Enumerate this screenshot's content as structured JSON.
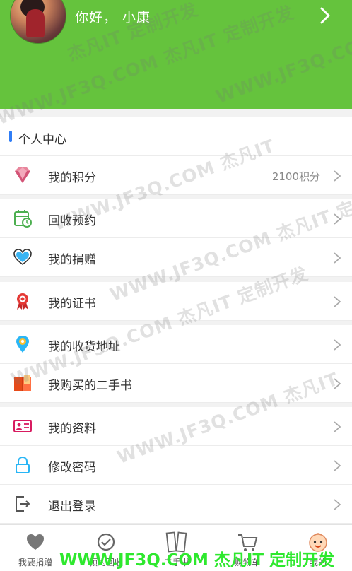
{
  "header": {
    "greeting": "你好， 小康",
    "colors": {
      "background": "#65c33d"
    },
    "icons": {
      "avatar": "user-avatar-photo",
      "arrow": "chevron-right-icon"
    }
  },
  "section_title": "个人中心",
  "menu": [
    {
      "label": "我的积分",
      "value": "2100积分",
      "icon": "diamond-icon"
    },
    {
      "label": "回收预约",
      "icon": "calendar-clock-icon"
    },
    {
      "label": "我的捐赠",
      "icon": "heart-icon"
    },
    {
      "label": "我的证书",
      "icon": "award-ribbon-icon"
    },
    {
      "label": "我的收货地址",
      "icon": "location-pin-icon"
    },
    {
      "label": "我购买的二手书",
      "icon": "open-book-icon"
    },
    {
      "label": "我的资料",
      "icon": "id-card-icon"
    },
    {
      "label": "修改密码",
      "icon": "lock-icon"
    },
    {
      "label": "退出登录",
      "icon": "logout-icon"
    }
  ],
  "tabbar": [
    {
      "label": "我要捐赠",
      "icon": "heart-tab-icon"
    },
    {
      "label": "预约回收",
      "icon": "check-circle-icon"
    },
    {
      "label": "二手书",
      "icon": "books-icon"
    },
    {
      "label": "购物车",
      "icon": "cart-icon"
    },
    {
      "label": "我的",
      "icon": "baby-face-icon"
    }
  ],
  "watermarks": {
    "text1": "WWW.JF3Q.COM 杰凡IT 定制开发",
    "text2": "WWW.JF3Q.COM 杰凡IT",
    "text3": "杰凡IT 定制开发",
    "footer": "WWW.JF3Q.COM 杰凡IT  定制开发"
  }
}
